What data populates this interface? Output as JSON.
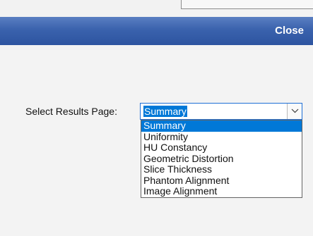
{
  "header": {
    "close_label": "Close"
  },
  "form": {
    "label": "Select Results Page:",
    "selected_value": "Summary"
  },
  "dropdown": {
    "options": [
      "Summary",
      "Uniformity",
      "HU Constancy",
      "Geometric Distortion",
      "Slice Thickness",
      "Phantom Alignment",
      "Image Alignment"
    ],
    "highlighted_index": 0
  },
  "colors": {
    "header_top": "#5a7fc2",
    "header_bottom": "#2d54a0",
    "selection": "#0078d7",
    "focus_border": "#1e6fd6"
  },
  "icons": {
    "dropdown_arrow": "chevron-down-icon"
  }
}
